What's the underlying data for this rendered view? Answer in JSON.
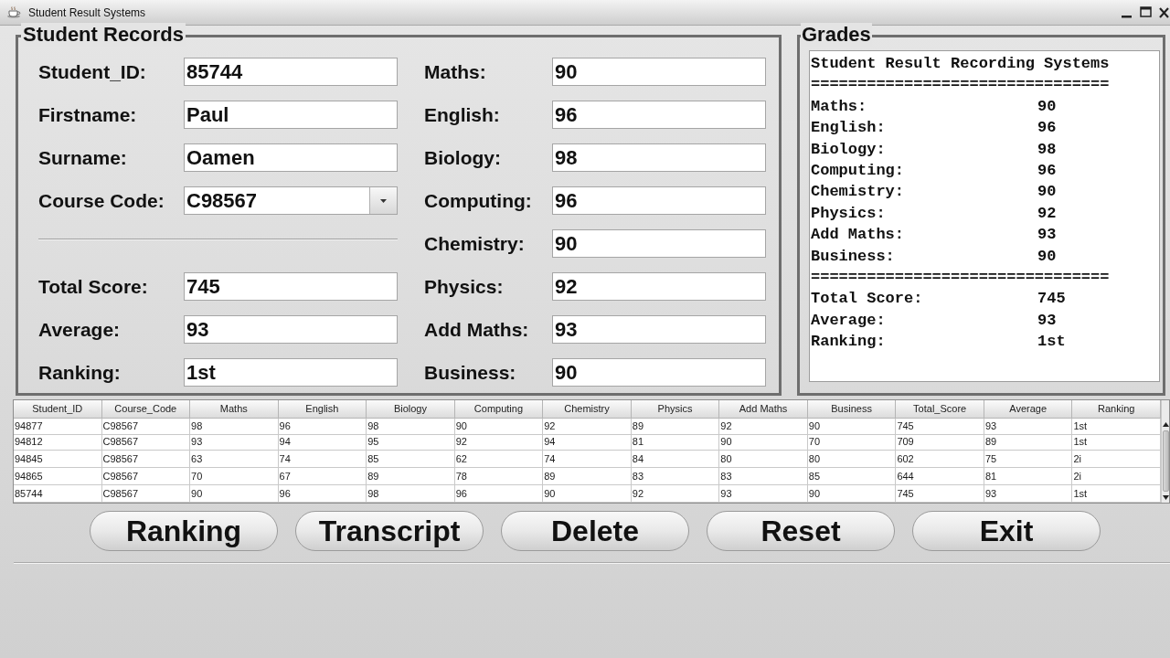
{
  "window": {
    "title": "Student Result Systems"
  },
  "student_records": {
    "title": "Student Records",
    "details": [
      {
        "label": "Student_ID:",
        "value": "85744",
        "kind": "text"
      },
      {
        "label": "Firstname:",
        "value": "Paul",
        "kind": "text"
      },
      {
        "label": "Surname:",
        "value": "Oamen",
        "kind": "text"
      },
      {
        "label": "Course Code:",
        "value": "C98567",
        "kind": "combo"
      }
    ],
    "totals": [
      {
        "label": "Total Score:",
        "value": "745"
      },
      {
        "label": "Average:",
        "value": "93"
      },
      {
        "label": "Ranking:",
        "value": "1st"
      }
    ],
    "subjects": [
      {
        "label": "Maths:",
        "value": "90"
      },
      {
        "label": "English:",
        "value": "96"
      },
      {
        "label": "Biology:",
        "value": "98"
      },
      {
        "label": "Computing:",
        "value": "96"
      },
      {
        "label": "Chemistry:",
        "value": "90"
      },
      {
        "label": "Physics:",
        "value": "92"
      },
      {
        "label": "Add Maths:",
        "value": "93"
      },
      {
        "label": "Business:",
        "value": "90"
      }
    ]
  },
  "grades": {
    "title": "Grades",
    "lines": [
      {
        "kind": "heading",
        "text": "Student Result Recording Systems"
      },
      {
        "kind": "rule",
        "text": "================================"
      },
      {
        "kind": "entry",
        "label": "Maths:",
        "value": "90"
      },
      {
        "kind": "entry",
        "label": "English:",
        "value": "96"
      },
      {
        "kind": "entry",
        "label": "Biology:",
        "value": "98"
      },
      {
        "kind": "entry",
        "label": "Computing:",
        "value": "96"
      },
      {
        "kind": "entry",
        "label": "Chemistry:",
        "value": "90"
      },
      {
        "kind": "entry",
        "label": "Physics:",
        "value": "92"
      },
      {
        "kind": "entry",
        "label": "Add Maths:",
        "value": "93"
      },
      {
        "kind": "entry",
        "label": "Business:",
        "value": "90"
      },
      {
        "kind": "rule",
        "text": "================================"
      },
      {
        "kind": "entry",
        "label": "Total Score:",
        "value": "745"
      },
      {
        "kind": "entry",
        "label": "Average:",
        "value": "93"
      },
      {
        "kind": "entry",
        "label": "Ranking:",
        "value": "1st"
      }
    ]
  },
  "table": {
    "columns": [
      "Student_ID",
      "Course_Code",
      "Maths",
      "English",
      "Biology",
      "Computing",
      "Chemistry",
      "Physics",
      "Add Maths",
      "Business",
      "Total_Score",
      "Average",
      "Ranking"
    ],
    "rows": [
      [
        "94877",
        "C98567",
        "98",
        "96",
        "98",
        "90",
        "92",
        "89",
        "92",
        "90",
        "745",
        "93",
        "1st"
      ],
      [
        "94812",
        "C98567",
        "93",
        "94",
        "95",
        "92",
        "94",
        "81",
        "90",
        "70",
        "709",
        "89",
        "1st"
      ],
      [
        "94845",
        "C98567",
        "63",
        "74",
        "85",
        "62",
        "74",
        "84",
        "80",
        "80",
        "602",
        "75",
        "2i"
      ],
      [
        "94865",
        "C98567",
        "70",
        "67",
        "89",
        "78",
        "89",
        "83",
        "83",
        "85",
        "644",
        "81",
        "2i"
      ],
      [
        "85744",
        "C98567",
        "90",
        "96",
        "98",
        "96",
        "90",
        "92",
        "93",
        "90",
        "745",
        "93",
        "1st"
      ]
    ]
  },
  "buttons": [
    "Ranking",
    "Transcript",
    "Delete",
    "Reset",
    "Exit"
  ]
}
